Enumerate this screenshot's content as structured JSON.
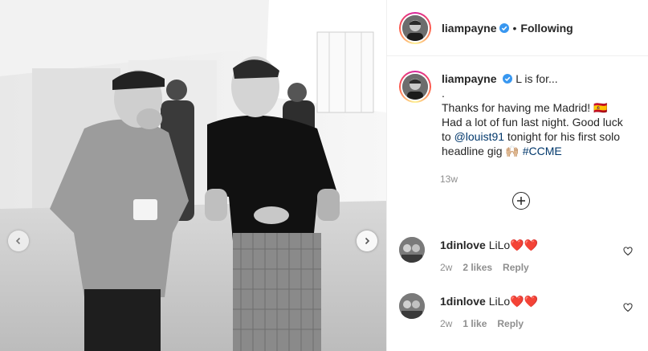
{
  "post": {
    "username": "liampayne",
    "follow_label": "Following",
    "separator": "•",
    "caption_line1": "L is for...",
    "caption_dot": ".",
    "caption_line2a": "Thanks for having me Madrid! 🇪🇸",
    "caption_line3": "Had a lot of fun last night. Good luck",
    "caption_to": "to ",
    "caption_mention": "@louist91",
    "caption_line4b": " tonight for his first solo",
    "caption_line5a": "headline gig 🙌🏼 ",
    "caption_hashtag": "#CCME",
    "time": "13w"
  },
  "comments": [
    {
      "username": "1dinlove",
      "text": "LiLo❤️❤️",
      "age": "2w",
      "likes": "2 likes",
      "reply": "Reply"
    },
    {
      "username": "1dinlove",
      "text": "LiLo❤️❤️",
      "age": "2w",
      "likes": "1 like",
      "reply": "Reply"
    }
  ],
  "icons": {
    "verified": "verified-badge-icon",
    "load_more": "plus-circle-icon",
    "like": "heart-outline-icon",
    "prev": "chevron-left-icon",
    "next": "chevron-right-icon"
  },
  "colors": {
    "text": "#262626",
    "muted": "#8e8e8e",
    "link": "#00376b",
    "verified": "#3897f0",
    "border": "#efefef"
  }
}
